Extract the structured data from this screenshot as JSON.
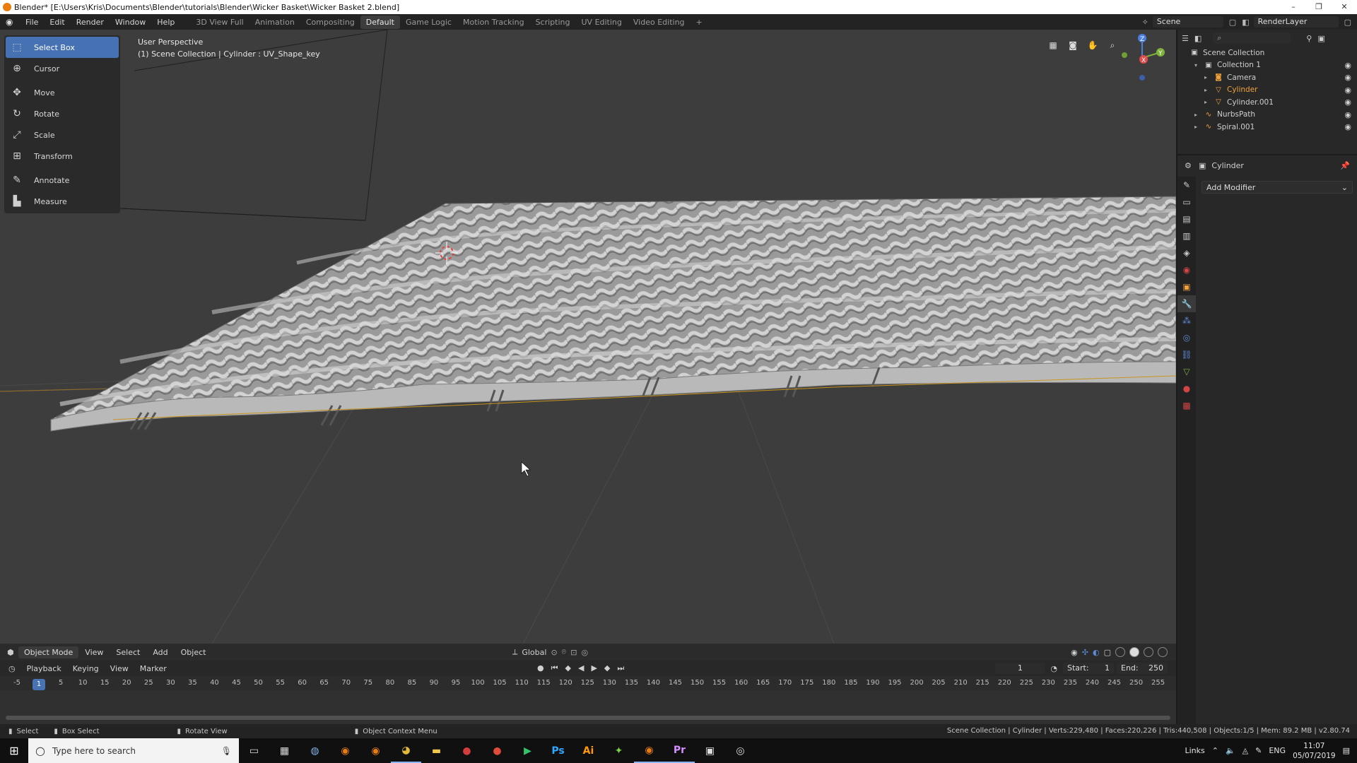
{
  "titlebar": {
    "title": "Blender* [E:\\Users\\Kris\\Documents\\Blender\\tutorials\\Blender\\Wicker Basket\\Wicker Basket 2.blend]",
    "minimize": "–",
    "restore": "❐",
    "close": "✕"
  },
  "menu": {
    "items": [
      "File",
      "Edit",
      "Render",
      "Window",
      "Help"
    ]
  },
  "workspaces": {
    "tabs": [
      "3D View Full",
      "Animation",
      "Compositing",
      "Default",
      "Game Logic",
      "Motion Tracking",
      "Scripting",
      "UV Editing",
      "Video Editing"
    ],
    "active": "Default",
    "add": "+"
  },
  "scene": {
    "label": "Scene"
  },
  "renderlayer": {
    "label": "RenderLayer"
  },
  "tools": [
    {
      "label": "Select Box",
      "icon": "select-box-icon",
      "glyph": "⬚"
    },
    {
      "label": "Cursor",
      "icon": "cursor-icon",
      "glyph": "⊕"
    },
    {
      "label": "Move",
      "icon": "move-icon",
      "glyph": "✥"
    },
    {
      "label": "Rotate",
      "icon": "rotate-icon",
      "glyph": "↻"
    },
    {
      "label": "Scale",
      "icon": "scale-icon",
      "glyph": "⤢"
    },
    {
      "label": "Transform",
      "icon": "transform-icon",
      "glyph": "⊞"
    },
    {
      "label": "Annotate",
      "icon": "annotate-icon",
      "glyph": "✎"
    },
    {
      "label": "Measure",
      "icon": "measure-icon",
      "glyph": "📐"
    }
  ],
  "viewport": {
    "perspective": "User Perspective",
    "collection_path": "(1) Scene Collection | Cylinder : UV_Shape_key",
    "mode": "Object Mode",
    "header_items": [
      "View",
      "Select",
      "Add",
      "Object"
    ],
    "orientation": "Global"
  },
  "outliner": {
    "root": "Scene Collection",
    "rows": [
      {
        "label": "Collection 1",
        "indent": 1,
        "icon": "collection-icon",
        "selected": false
      },
      {
        "label": "Camera",
        "indent": 2,
        "icon": "camera-icon",
        "selected": false
      },
      {
        "label": "Cylinder",
        "indent": 2,
        "icon": "mesh-icon",
        "selected": true
      },
      {
        "label": "Cylinder.001",
        "indent": 2,
        "icon": "mesh-icon",
        "selected": false
      },
      {
        "label": "NurbsPath",
        "indent": 1,
        "icon": "curve-icon",
        "selected": false
      },
      {
        "label": "Spiral.001",
        "indent": 1,
        "icon": "curve-icon",
        "selected": false
      }
    ]
  },
  "properties": {
    "object_name": "Cylinder",
    "add_modifier": "Add Modifier"
  },
  "timeline": {
    "header_items": [
      "Playback",
      "Keying",
      "View",
      "Marker"
    ],
    "current_frame": "1",
    "start_label": "Start:",
    "start": "1",
    "end_label": "End:",
    "end": "250",
    "ruler": [
      "-5",
      "1",
      "5",
      "10",
      "15",
      "20",
      "25",
      "30",
      "35",
      "40",
      "45",
      "50",
      "55",
      "60",
      "65",
      "70",
      "75",
      "80",
      "85",
      "90",
      "95",
      "100",
      "105",
      "110",
      "115",
      "120",
      "125",
      "130",
      "135",
      "140",
      "145",
      "150",
      "155",
      "160",
      "165",
      "170",
      "175",
      "180",
      "185",
      "190",
      "195",
      "200",
      "205",
      "210",
      "215",
      "220",
      "225",
      "230",
      "235",
      "240",
      "245",
      "250",
      "255"
    ]
  },
  "statusbar": {
    "select": "Select",
    "box_select": "Box Select",
    "rotate_view": "Rotate View",
    "context_menu": "Object Context Menu",
    "stats": "Scene Collection | Cylinder | Verts:229,480 | Faces:220,226 | Tris:440,508 | Objects:1/5 | Mem: 89.2 MB | v2.80.74"
  },
  "taskbar": {
    "search_placeholder": "Type here to search",
    "apps": [
      {
        "icon": "task-view-icon",
        "glyph": "▭",
        "color": "#dddddd",
        "open": false
      },
      {
        "icon": "calculator-icon",
        "glyph": "▦",
        "color": "#dddddd",
        "open": false
      },
      {
        "icon": "app-icon",
        "glyph": "◍",
        "color": "#7fb2e5",
        "open": false
      },
      {
        "icon": "blender-icon",
        "glyph": "◉",
        "color": "#e87d0d",
        "open": false
      },
      {
        "icon": "blender-icon",
        "glyph": "◉",
        "color": "#e87d0d",
        "open": false
      },
      {
        "icon": "chrome-icon",
        "glyph": "◕",
        "color": "#e2b93b",
        "open": true
      },
      {
        "icon": "file-explorer-icon",
        "glyph": "▬",
        "color": "#f2c94c",
        "open": false
      },
      {
        "icon": "app-icon",
        "glyph": "●",
        "color": "#d33d3d",
        "open": false
      },
      {
        "icon": "app-icon",
        "glyph": "●",
        "color": "#e04b3c",
        "open": false
      },
      {
        "icon": "play-icon",
        "glyph": "▶",
        "color": "#33c36b",
        "open": false
      },
      {
        "icon": "photoshop-icon",
        "glyph": "Ps",
        "color": "#31a8ff",
        "open": false
      },
      {
        "icon": "illustrator-icon",
        "glyph": "Ai",
        "color": "#ff9a00",
        "open": false
      },
      {
        "icon": "app-icon",
        "glyph": "✦",
        "color": "#7ad14a",
        "open": false
      },
      {
        "icon": "blender-icon",
        "glyph": "◉",
        "color": "#e87d0d",
        "open": true
      },
      {
        "icon": "premiere-icon",
        "glyph": "Pr",
        "color": "#d291ff",
        "open": true
      },
      {
        "icon": "photos-icon",
        "glyph": "▣",
        "color": "#dddddd",
        "open": false
      },
      {
        "icon": "app-icon",
        "glyph": "◎",
        "color": "#dddddd",
        "open": false
      }
    ],
    "tray_links": "Links",
    "language": "ENG",
    "time": "11:07",
    "date": "05/07/2019"
  },
  "colors": {
    "accent": "#4772b3",
    "selected_object": "#f0a23c",
    "viewport_bg": "#3d3d3d",
    "panel_bg": "#282828"
  }
}
